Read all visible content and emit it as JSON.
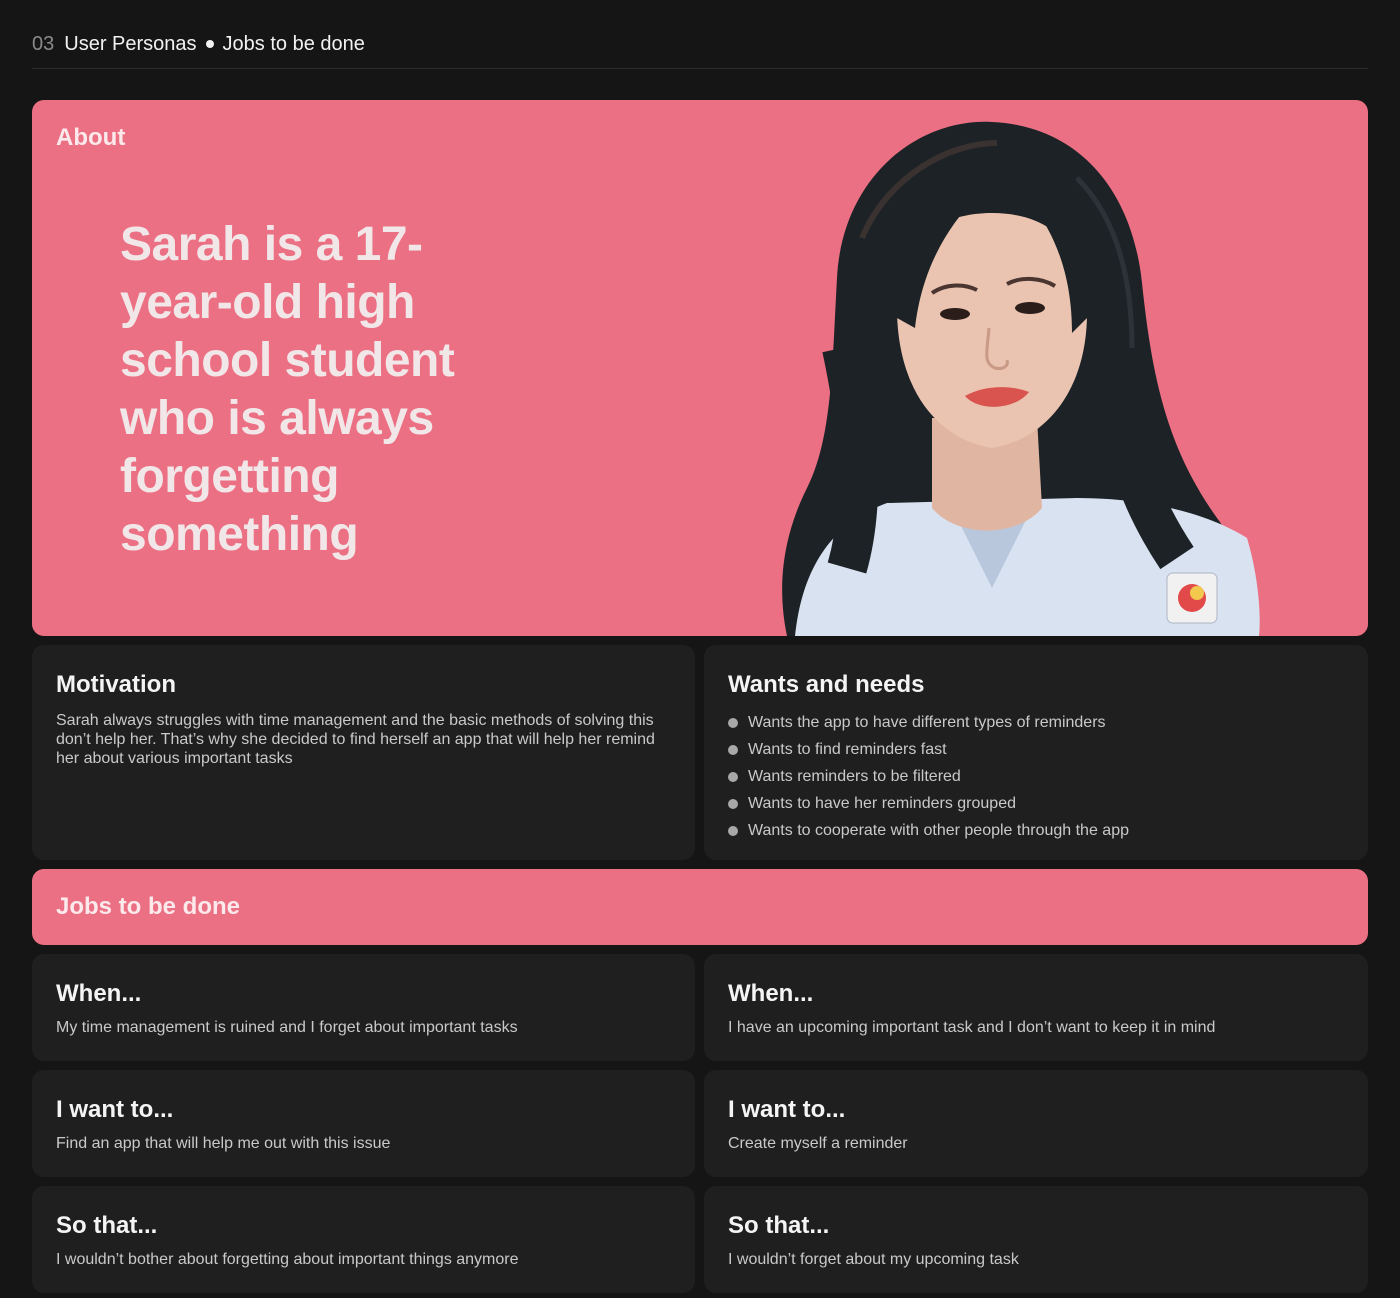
{
  "header": {
    "number": "03",
    "title": "User Personas",
    "subtitle": "Jobs to be done"
  },
  "about": {
    "label": "About",
    "headline": "Sarah is a 17-year-old high school student who is always forgetting something",
    "photo": "portrait of Sarah"
  },
  "motivation": {
    "title": "Motivation",
    "text": "Sarah always struggles with time management and the basic methods of solving this don’t help her. That’s why she decided to find herself an app that will help her remind her about various important tasks"
  },
  "wants": {
    "title": "Wants and needs",
    "items": [
      "Wants the app to have different types of reminders",
      "Wants to find reminders fast",
      "Wants reminders to be filtered",
      "Wants to have her reminders grouped",
      "Wants to cooperate with other people through the app"
    ]
  },
  "jobs": {
    "label": "Jobs to be done",
    "cards": [
      {
        "title": "When...",
        "text": "My time management is ruined and I forget about important tasks"
      },
      {
        "title": "When...",
        "text": "I have an upcoming important task and I don’t want to keep it in mind"
      },
      {
        "title": "I want to...",
        "text": "Find an app that will help me out with this issue"
      },
      {
        "title": "I want to...",
        "text": "Create myself a reminder"
      },
      {
        "title": "So that...",
        "text": "I wouldn’t bother about forgetting about important things anymore"
      },
      {
        "title": "So that...",
        "text": "I wouldn’t forget about my upcoming task"
      }
    ]
  },
  "colors": {
    "accent": "#ec7083",
    "background": "#151515",
    "card": "#1f1f1f"
  }
}
